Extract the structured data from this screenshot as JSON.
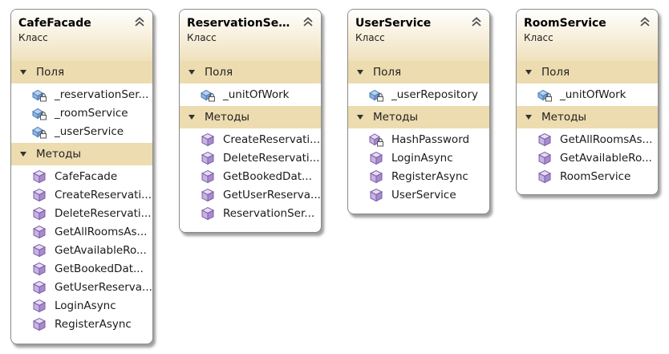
{
  "stereotype": "Класс",
  "section_labels": {
    "fields": "Поля",
    "methods": "Методы"
  },
  "icons": {
    "collapse": "double-chevron-up-icon",
    "section_toggle": "triangle-down-icon",
    "field": "field-lock-icon",
    "method": "method-cube-icon",
    "private_method": "private-method-lock-icon"
  },
  "colors": {
    "header_gradient_end": "#efe1bd",
    "section_background": "#eddcb0",
    "icon_purple": "#7b5ea7",
    "icon_blue": "#4a7ab5"
  },
  "classes": [
    {
      "title": "CafeFacade",
      "fields": [
        "_reservationSer...",
        "_roomService",
        "_userService"
      ],
      "methods": [
        "CafeFacade",
        "CreateReservati...",
        "DeleteReservati...",
        "GetAllRoomsAs...",
        "GetAvailableRo...",
        "GetBookedDat...",
        "GetUserReserva...",
        "LoginAsync",
        "RegisterAsync"
      ]
    },
    {
      "title": "ReservationServ...",
      "fields": [
        "_unitOfWork"
      ],
      "methods": [
        "CreateReservati...",
        "DeleteReservati...",
        "GetBookedDat...",
        "GetUserReserva...",
        "ReservationSer..."
      ]
    },
    {
      "title": "UserService",
      "fields": [
        "_userRepository"
      ],
      "methods": [
        "HashPassword",
        "LoginAsync",
        "RegisterAsync",
        "UserService"
      ]
    },
    {
      "title": "RoomService",
      "fields": [
        "_unitOfWork"
      ],
      "methods": [
        "GetAllRoomsAs...",
        "GetAvailableRo...",
        "RoomService"
      ]
    }
  ]
}
